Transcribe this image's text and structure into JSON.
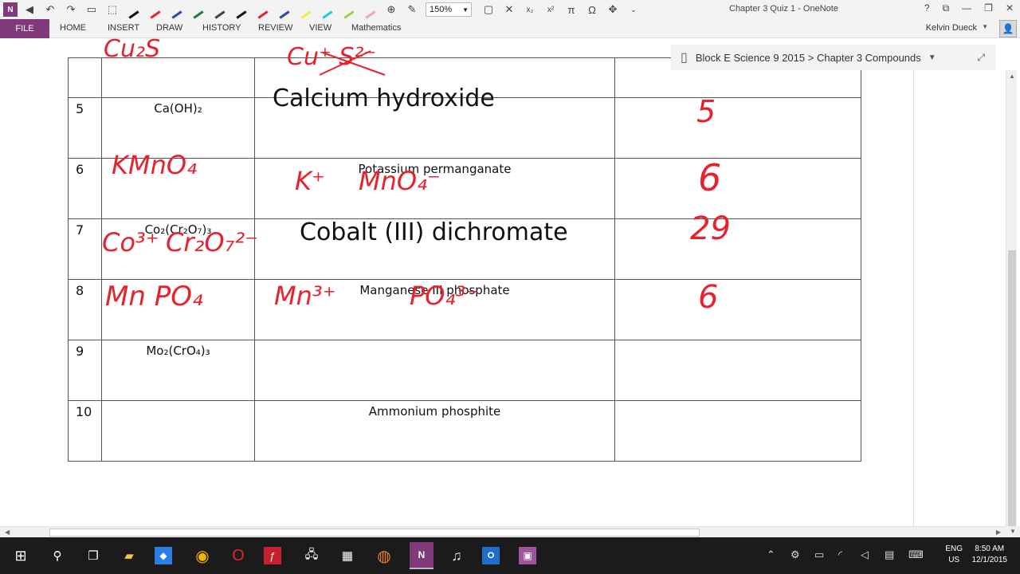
{
  "window": {
    "title": "Chapter 3 Quiz 1 - OneNote",
    "controls": [
      "?",
      "⧉",
      "—",
      "❐",
      "✕"
    ]
  },
  "quick_access": {
    "app_icon": "onenote-icon",
    "zoom_value": "150%",
    "pen_colors": [
      "#111111",
      "#e8222d",
      "#1f4fa8",
      "#1b7a3b",
      "#444444",
      "#111111",
      "#e8222d",
      "#1f4fa8",
      "#f5e84a",
      "#28c6e6",
      "#9ad04a",
      "#f0a4c0"
    ],
    "symbol_labels": [
      "x₂",
      "x²",
      "π",
      "Ω"
    ]
  },
  "ribbon": {
    "file_label": "FILE",
    "tabs": [
      "HOME",
      "INSERT",
      "DRAW",
      "HISTORY",
      "REVIEW",
      "VIEW",
      "Mathematics"
    ],
    "user_name": "Kelvin Dueck"
  },
  "breadcrumb": {
    "notebook": "Block E Science 9 2015",
    "separator": " > ",
    "section": "Chapter 3 Compounds"
  },
  "table": {
    "rows": [
      {
        "number": "5",
        "formula": "Ca(OH)₂",
        "name": "",
        "answer": ""
      },
      {
        "number": "6",
        "formula": "",
        "name": "Potassium permanganate",
        "answer": ""
      },
      {
        "number": "7",
        "formula": "Co₂(Cr₂O₇)₃",
        "name": "",
        "answer": ""
      },
      {
        "number": "8",
        "formula": "",
        "name": "Manganese III phosphate",
        "answer": ""
      },
      {
        "number": "9",
        "formula": "Mo₂(CrO₄)₃",
        "name": "",
        "answer": ""
      },
      {
        "number": "10",
        "formula": "",
        "name": "Ammonium phosphite",
        "answer": ""
      }
    ],
    "typed_large": {
      "row5": "Calcium hydroxide",
      "row7": "Cobalt (III) dichromate"
    }
  },
  "handwriting": {
    "top_formula": "Cu₂S",
    "top_ions": "Cu⁺ S²⁻",
    "row5_answer": "5",
    "row6_formula": "KMnO₄",
    "row6_ion_k": "K⁺",
    "row6_ion_mno4": "MnO₄⁻",
    "row6_answer": "6",
    "row7_ion_co": "Co³⁺",
    "row7_ion_cr2o7": "Cr₂O₇²⁻",
    "row7_answer": "29",
    "row8_formula": "Mn PO₄",
    "row8_ion_mn": "Mn³⁺",
    "row8_ion_po4": "PO₄³⁻",
    "row8_answer": "6"
  },
  "taskbar": {
    "apps": [
      "windows-start-icon",
      "search-icon",
      "task-view-icon",
      "file-explorer-icon",
      "dropbox-icon",
      "chrome-icon",
      "opera-icon",
      "flash-icon",
      "network-icon",
      "calculator-icon",
      "firefox-icon",
      "onenote-icon",
      "itunes-icon",
      "outlook-icon",
      "teams-icon"
    ],
    "language_top": "ENG",
    "language_bottom": "US",
    "time": "8:50 AM",
    "date": "12/1/2015"
  }
}
